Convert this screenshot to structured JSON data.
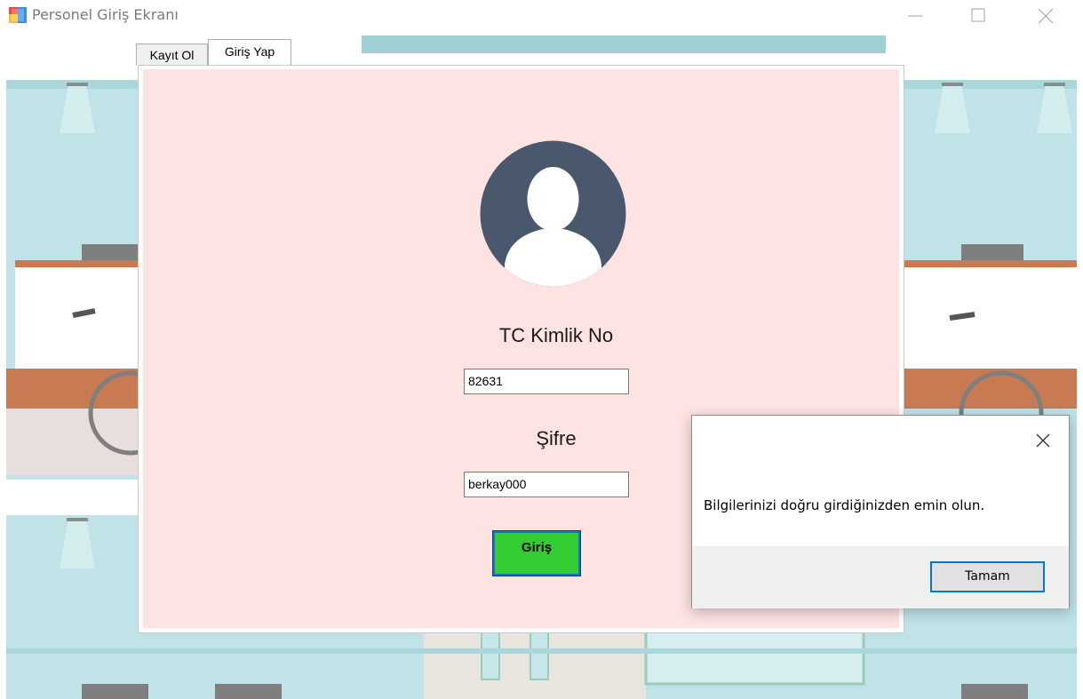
{
  "window": {
    "title": "Personel Giriş Ekranı"
  },
  "tabs": [
    {
      "label": "Kayıt Ol",
      "active": false
    },
    {
      "label": "Giriş Yap",
      "active": true
    }
  ],
  "login_form": {
    "tc_label": "TC Kimlik No",
    "tc_value": "82631",
    "password_label": "Şifre",
    "password_value": "berkay000",
    "submit_label": "Giriş"
  },
  "message_box": {
    "text": "Bilgilerinizi doğru girdiğinizden emin olun.",
    "ok_label": "Tamam"
  },
  "colors": {
    "form_background": "#fde3e1",
    "submit_button": "#33cc33",
    "avatar": "#4a586e",
    "accent_border": "#0078d7"
  },
  "icons": {
    "app": "windows-form-icon",
    "avatar": "user-silhouette-icon",
    "minimize": "minimize-icon",
    "maximize": "maximize-icon",
    "close": "close-icon"
  }
}
